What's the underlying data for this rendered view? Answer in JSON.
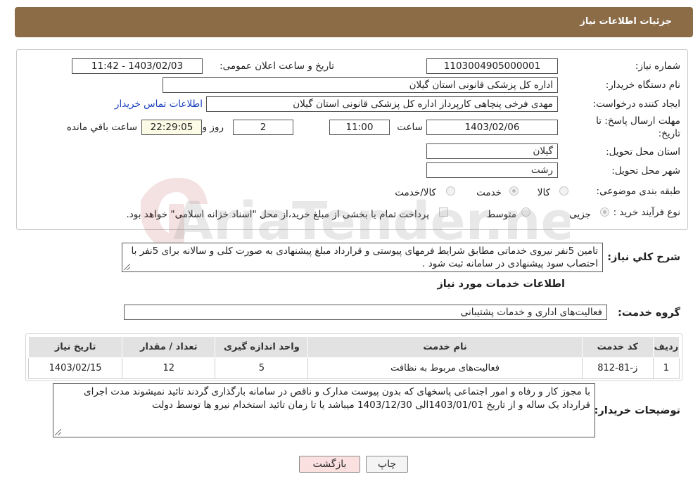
{
  "header": {
    "title": "جزئیات اطلاعات نیاز"
  },
  "form": {
    "need_number_label": "شماره نیاز:",
    "need_number": "1103004905000001",
    "announce_label": "تاریخ و ساعت اعلان عمومی:",
    "announce_value": "1403/02/03 - 11:42",
    "buyer_org_label": "نام دستگاه خریدار:",
    "buyer_org": "اداره کل پزشکی قانونی استان گیلان",
    "creator_label": "ایجاد کننده درخواست:",
    "creator": "مهدی فرخی پنچاهی کارپرداز  اداره کل پزشکی قانونی استان گیلان",
    "contact_link": "اطلاعات تماس خریدار",
    "deadline_label_1": "مهلت ارسال پاسخ: تا",
    "deadline_label_2": "تاریخ:",
    "deadline_date": "1403/02/06",
    "time_label": "ساعت",
    "deadline_time": "11:00",
    "days_value": "2",
    "days_label": "روز و",
    "remaining_time": "22:29:05",
    "remaining_label": "ساعت باقي مانده",
    "province_label": "استان محل تحویل:",
    "province": "گیلان",
    "city_label": "شهر محل تحویل:",
    "city": "رشت",
    "category_label": "طبقه بندی موضوعی:",
    "category_options": [
      "کالا",
      "خدمت",
      "کالا/خدمت"
    ],
    "process_label": "نوع فرآیند خرید :",
    "process_options": [
      "جزیی",
      "متوسط"
    ],
    "payment_note": "پرداخت تمام یا بخشی از مبلغ خرید،از محل \"اسناد خزانه اسلامی\" خواهد بود."
  },
  "description": {
    "label": "شرح کلي نياز:",
    "text": "تامین 5نفر نیروی خدماتی مطابق شرایط فرمهای پیوستی و قرارداد مبلغ پیشنهادی به صورت کلی و سالانه برای 5نفر با احتصاب سود پیشنهادی در سامانه ثبت شود ."
  },
  "services": {
    "section_title": "اطلاعات خدمات مورد نياز",
    "group_label": "گروه خدمت:",
    "group_value": "فعالیت‌های اداری و خدمات پشتیبانی",
    "columns": [
      "رديف",
      "کد خدمت",
      "نام خدمت",
      "واحد اندازه گيری",
      "تعداد / مقدار",
      "تاريخ نياز"
    ],
    "rows": [
      {
        "index": "1",
        "code": "ز-81-812",
        "name": "فعالیت‌های مربوط به نظافت",
        "unit": "5",
        "qty": "12",
        "date": "1403/02/15"
      }
    ]
  },
  "buyer_notes": {
    "label": "توضیحات خریدار:",
    "text": "با مجوز کار و رفاه  و امور اجتماعی پاسخهای که بدون پیوست مدارک و ناقص در سامانه بارگذاری گردند تائید نمیشوند مدت اجرای قرارداد یک ساله و از تاریخ 1403/01/01الی 1403/12/30 میباشد یا تا زمان تائید استخدام نیرو ها توسط دولت"
  },
  "buttons": {
    "print": "چاپ",
    "back": "بازگشت"
  },
  "watermark": {
    "text": "AriaTender.net"
  },
  "colors": {
    "header_bg": "#8b6c47",
    "back_button_bg": "#fbe0e0",
    "table_header_bg": "#e2e2e2"
  }
}
